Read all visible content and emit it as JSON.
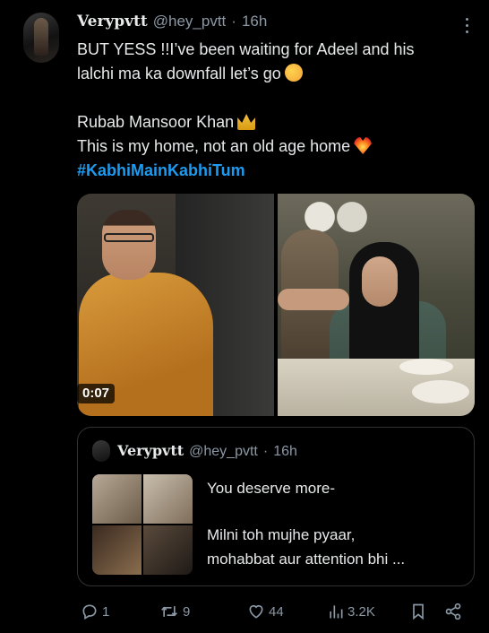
{
  "tweet": {
    "display_name": "Verypvtt",
    "handle": "@hey_pvtt",
    "separator": "·",
    "time": "16h",
    "lines": {
      "l1": "BUT YESS !!I’ve been waiting for Adeel and his",
      "l2": "lalchi ma ka downfall let’s go",
      "l3": "Rubab Mansoor Khan",
      "l4": "This is my home, not an old age home",
      "hashtag": "#KabhiMainKabhiTum"
    },
    "video_duration": "0:07"
  },
  "quoted_tweet": {
    "display_name": "Verypvtt",
    "handle": "@hey_pvtt",
    "separator": "·",
    "time": "16h",
    "lines": {
      "l1": "You deserve more-",
      "l2": "Milni toh mujhe pyaar,",
      "l3": "mohabbat aur attention bhi ..."
    }
  },
  "actions": {
    "replies": "1",
    "reposts": "9",
    "likes": "44",
    "views": "3.2K"
  },
  "icons": {
    "more": "more-dots-icon",
    "reply": "reply-icon",
    "repost": "repost-icon",
    "like": "heart-icon",
    "views": "views-icon",
    "bookmark": "bookmark-icon",
    "share": "share-icon"
  },
  "colors": {
    "background": "#000000",
    "text": "#e7e9ea",
    "muted": "#8b98a5",
    "link": "#1d9bf0",
    "border": "#2f3336"
  }
}
